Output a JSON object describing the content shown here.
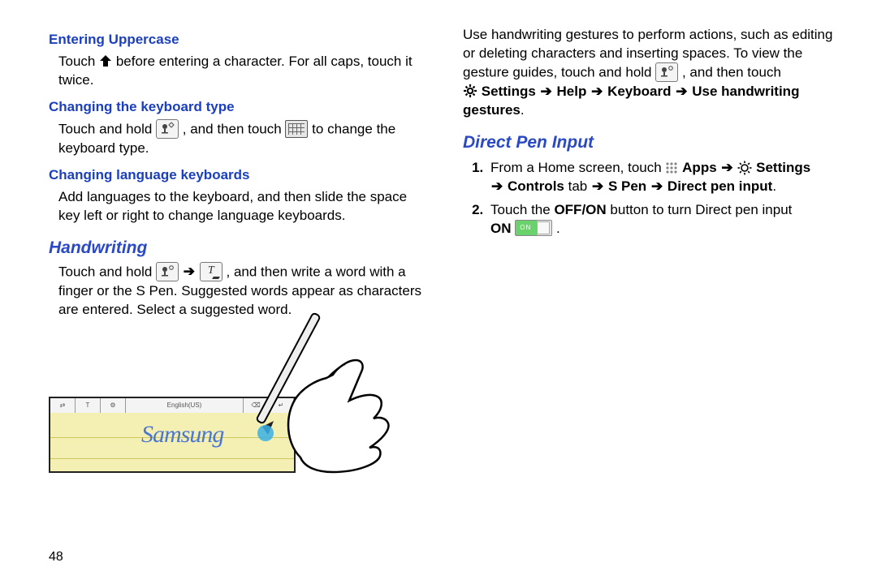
{
  "pageNumber": "48",
  "left": {
    "h_uppercase": "Entering Uppercase",
    "p_uppercase_1": "Touch ",
    "p_uppercase_2": " before entering a character. For all caps, touch it twice.",
    "h_kbtype": "Changing the keyboard type",
    "p_kbtype_1": "Touch and hold ",
    "p_kbtype_2": " , and then touch ",
    "p_kbtype_3": " to change the keyboard type.",
    "h_lang": "Changing language keyboards",
    "p_lang": "Add languages to the keyboard, and then slide the space key left or right to change language keyboards.",
    "h_handwriting": "Handwriting",
    "p_hw_1": "Touch and hold ",
    "p_hw_2": " , and then write a word with a finger or the S Pen. Suggested words appear as characters are entered. Select a suggested word.",
    "illust_text": "Samsung",
    "illust_lang": "English(US)"
  },
  "right": {
    "p_gestures_1": "Use handwriting gestures to perform actions, such as editing or deleting characters and inserting spaces. To view the gesture guides, touch and hold ",
    "p_gestures_2": " , and then touch",
    "nav_settings": "Settings",
    "nav_help": "Help",
    "nav_keyboard": "Keyboard",
    "nav_usehw": "Use handwriting gestures",
    "h_direct": "Direct Pen Input",
    "step1_a": "From a Home screen, touch ",
    "step1_apps": "Apps",
    "step1_settings": "Settings",
    "step1_controls": "Controls",
    "step1_tab": " tab ",
    "step1_spen": "S Pen",
    "step1_dpi": "Direct pen input",
    "step2_a": "Touch the ",
    "step2_offon": "OFF/ON",
    "step2_b": " button to turn Direct pen input ",
    "step2_on": "ON"
  }
}
